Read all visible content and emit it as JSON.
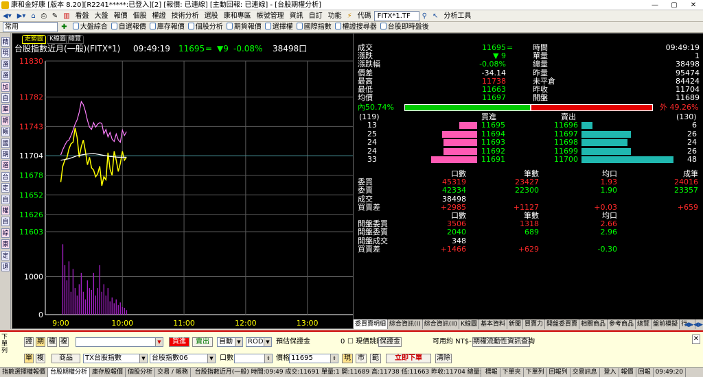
{
  "window": {
    "title": "康和金好康 [版本 8.20][R2241*****:已登入][2] [報價: 已連線] [主動回報: 已連線] - [台股期權分析]",
    "min": "—",
    "max": "▢",
    "close": "✕"
  },
  "menu": {
    "items": [
      "看盤",
      "大盤",
      "報價",
      "個股",
      "權證",
      "技術分析",
      "選股",
      "康和專區",
      "帳號管理",
      "資訊",
      "自訂",
      "功能"
    ],
    "symbol_label": "代碼",
    "symbol_value": "FITX*1.TF",
    "analysis": "分析工具"
  },
  "quickbar": {
    "preset": "常用",
    "items": [
      "大盤綜合",
      "自選報價",
      "庫存報價",
      "個股分析",
      "期貨報價",
      "選擇權",
      "國際指數",
      "權證搜尋器",
      "台股即時盤後"
    ]
  },
  "leftstrip": [
    "精",
    "現",
    "選",
    "選",
    "加",
    "自",
    "庫",
    "期",
    "帳",
    "國",
    "期",
    "選",
    "台",
    "定",
    "自",
    "權",
    "自",
    "綜",
    "康",
    "定",
    "退"
  ],
  "chart": {
    "tabs": [
      "走勢圖",
      "K線圖",
      "總覽"
    ],
    "name": "台股指數近月(一般)(FITX*1)",
    "time": "09:49:19",
    "price": "11695",
    "price_mark": "=",
    "change": "▼9",
    "change_pct": "-0.08%",
    "volume": "38498口",
    "price_ticks": [
      {
        "v": 11830,
        "c": "#ff2a2a"
      },
      {
        "v": 11782,
        "c": "#ff2a2a"
      },
      {
        "v": 11743,
        "c": "#ff2a2a"
      },
      {
        "v": 11704,
        "c": "#ffffff"
      },
      {
        "v": 11678,
        "c": "#00ff00"
      },
      {
        "v": 11652,
        "c": "#00ff00"
      },
      {
        "v": 11626,
        "c": "#00ff00"
      },
      {
        "v": 11603,
        "c": "#00ff00"
      }
    ],
    "vol_ticks": [
      "1000",
      "0"
    ],
    "time_ticks": [
      "9:00",
      "10:00",
      "11:00",
      "12:00",
      "13:00"
    ]
  },
  "chart_data": {
    "type": "line",
    "title": "台股指數近月(一般)(FITX*1)",
    "xlabel": "",
    "ylabel": "",
    "time_range": [
      "08:45",
      "13:45"
    ],
    "ylim": [
      11603,
      11830
    ],
    "ref_price": 11704,
    "series": [
      {
        "color": "#ff80ff",
        "t": [
          0,
          2,
          4,
          6,
          8,
          10,
          12,
          14,
          16,
          18,
          20,
          22,
          24,
          26,
          28,
          30,
          32,
          34,
          36,
          38,
          40,
          42,
          44,
          46,
          48,
          50,
          52,
          54,
          56,
          58,
          60,
          62,
          64
        ],
        "values": [
          11705,
          11712,
          11718,
          11723,
          11725,
          11731,
          11738,
          11746,
          11752,
          11762,
          11776,
          11772,
          11763,
          11751,
          11742,
          11739,
          11748,
          11742,
          11746,
          11748,
          11747,
          11733,
          11739,
          11729,
          11735,
          11726,
          11723,
          11733,
          11725,
          11722,
          11738,
          11731,
          11736
        ]
      },
      {
        "color": "#ffff00",
        "t": [
          0,
          2,
          4,
          6,
          8,
          10,
          12,
          14,
          16,
          18,
          20,
          22,
          24,
          26,
          28,
          30,
          32,
          34,
          36,
          38,
          40,
          42,
          44,
          46,
          48,
          50,
          52,
          54,
          56,
          58,
          60,
          62,
          64
        ],
        "values": [
          11669,
          11690,
          11698,
          11701,
          11713,
          11720,
          11722,
          11741,
          11728,
          11702,
          11716,
          11725,
          11710,
          11692,
          11702,
          11688,
          11685,
          11676,
          11680,
          11690,
          11664,
          11676,
          11672,
          11708,
          11686,
          11678,
          11710,
          11698,
          11683,
          11694,
          11710,
          11698,
          11702
        ]
      },
      {
        "color": "#ffffff",
        "t": [
          0,
          8,
          16,
          24,
          32,
          40,
          48,
          56,
          64
        ],
        "values": [
          11698,
          11700,
          11704,
          11706,
          11707,
          11705,
          11703,
          11702,
          11702
        ]
      }
    ],
    "volume": {
      "ymax": 2000,
      "t": [
        2,
        4,
        6,
        8,
        10,
        12,
        14,
        16,
        18,
        20,
        22,
        24,
        26,
        28,
        30,
        32,
        34,
        36,
        38,
        40,
        42,
        44,
        46,
        48,
        50,
        52,
        54,
        56,
        58,
        60,
        62,
        64
      ],
      "values": [
        1850,
        1300,
        900,
        1400,
        600,
        1200,
        700,
        500,
        800,
        1100,
        600,
        400,
        900,
        700,
        650,
        1100,
        500,
        700,
        1300,
        600,
        800,
        500,
        700,
        350,
        450,
        300,
        400,
        250,
        320,
        200,
        180,
        120
      ]
    }
  },
  "quote": {
    "left": [
      {
        "l": "成交",
        "v": "11695",
        "vc": "g",
        "x": "=",
        "l2": "時間",
        "v2": "09:49:19"
      },
      {
        "l": "漲跌",
        "v": "▼ 9",
        "vc": "g",
        "l2": "單量",
        "v2": "1"
      },
      {
        "l": "漲跌幅",
        "v": "-0.08%",
        "vc": "g",
        "l2": "總量",
        "v2": "38498"
      },
      {
        "l": "價差",
        "v": "-34.14",
        "vc": "w",
        "l2": "昨量",
        "v2": "95474"
      },
      {
        "l": "最高",
        "v": "11738",
        "vc": "r",
        "l2": "未平倉",
        "v2": "84424"
      },
      {
        "l": "最低",
        "v": "11663",
        "vc": "g",
        "l2": "昨收",
        "v2": "11704"
      },
      {
        "l": "均價",
        "v": "11697",
        "vc": "g",
        "l2": "開盤",
        "v2": "11689"
      }
    ],
    "inner_label": "內50.74%",
    "outer_label": "外 49.26%",
    "inner_pct": 50.74,
    "bid_total": "(119)",
    "ask_total": "(130)",
    "bid_hdr": "買進",
    "ask_hdr": "賣出",
    "depth": [
      {
        "bq": "13",
        "bp": "11695",
        "ap": "11696",
        "aq": "6",
        "bb": 0.27,
        "ab": 0.12
      },
      {
        "bq": "25",
        "bp": "11694",
        "ap": "11697",
        "aq": "26",
        "bb": 0.53,
        "ab": 0.54
      },
      {
        "bq": "24",
        "bp": "11693",
        "ap": "11698",
        "aq": "24",
        "bb": 0.51,
        "ab": 0.5
      },
      {
        "bq": "24",
        "bp": "11692",
        "ap": "11699",
        "aq": "26",
        "bb": 0.51,
        "ab": 0.54
      },
      {
        "bq": "33",
        "bp": "11691",
        "ap": "11700",
        "aq": "48",
        "bb": 0.7,
        "ab": 1.0
      }
    ],
    "stats_hdr": {
      "c1": "口數",
      "c2": "筆數",
      "c3": "均口",
      "c4": "成筆"
    },
    "stats": [
      {
        "l": "委買",
        "a": "45319",
        "ac": "r",
        "b": "23427",
        "bc": "r",
        "c": "1.93",
        "cc": "r",
        "d": "24016",
        "dc": "r"
      },
      {
        "l": "委賣",
        "a": "42334",
        "ac": "g",
        "b": "22300",
        "bc": "g",
        "c": "1.90",
        "cc": "g",
        "d": "23357",
        "dc": "g"
      },
      {
        "l": "成交",
        "a": "38498",
        "ac": "w",
        "b": "",
        "bc": "w",
        "c": "",
        "cc": "w",
        "d": "",
        "dc": "w"
      },
      {
        "l": "買賣差",
        "a": "+2985",
        "ac": "r",
        "b": "+1127",
        "bc": "r",
        "c": "+0.03",
        "cc": "r",
        "d": "+659",
        "dc": "r"
      }
    ],
    "open_hdr": {
      "c1": "口數",
      "c2": "筆數",
      "c3": "均口"
    },
    "open": [
      {
        "l": "開盤委買",
        "a": "3506",
        "ac": "r",
        "b": "1318",
        "bc": "r",
        "c": "2.66",
        "cc": "r"
      },
      {
        "l": "開盤委賣",
        "a": "2040",
        "ac": "g",
        "b": "689",
        "bc": "g",
        "c": "2.96",
        "cc": "g"
      },
      {
        "l": "開盤成交",
        "a": "348",
        "ac": "w",
        "b": "",
        "bc": "w",
        "c": "",
        "cc": "w"
      },
      {
        "l": "買賣差",
        "a": "+1466",
        "ac": "r",
        "b": "+629",
        "bc": "r",
        "c": "-0.30",
        "cc": "g"
      }
    ]
  },
  "infotabs": [
    "委買賣明細",
    "綜合資訊(I)",
    "綜合資訊(II)",
    "K線圖",
    "基本資料",
    "新聞",
    "買賣力",
    "開盤委買賣",
    "相關商品",
    "參考商品",
    "總覽",
    "盤前模擬",
    "行..."
  ],
  "order": {
    "label": "下單列",
    "r1": {
      "stock": "證",
      "fut": "期",
      "opt": "權",
      "rec": "複",
      "buy": "買進",
      "sell": "賣出",
      "auto": "自動",
      "rod": "ROD",
      "margin_label": "預估保證金",
      "margin_val": "0",
      "spot": "現價跳動",
      "margin_btn": "保證金",
      "avail": "可用約 NT$---",
      "query": "期權流動性資訊查詢"
    },
    "r2": {
      "single": "單",
      "compound": "複",
      "product_btn": "商品",
      "product": "TX台股指數",
      "month": "台股指數06",
      "qty_label": "口數",
      "price_label": "價格",
      "price": "11695",
      "market": "現",
      "mkt": "市",
      "limit": "範",
      "submit": "立即下單",
      "clear": "清除"
    }
  },
  "status": {
    "tabs": [
      "指數選擇權報價",
      "台股期權分析",
      "庫存股報價",
      "個股分析",
      "交易 / 帳務"
    ],
    "ticker": "台股指數近月(一般) 時間:09:49 成交:11691 單量:1 開:11689 高:11738 低:11663 昨收:11704 總量:38425",
    "buttons": [
      "標報",
      "下單夾",
      "下單列",
      "回報列",
      "交易訊息"
    ],
    "login": "登入",
    "quote": "報價",
    "report": "回報",
    "clock": "09:49:20"
  }
}
